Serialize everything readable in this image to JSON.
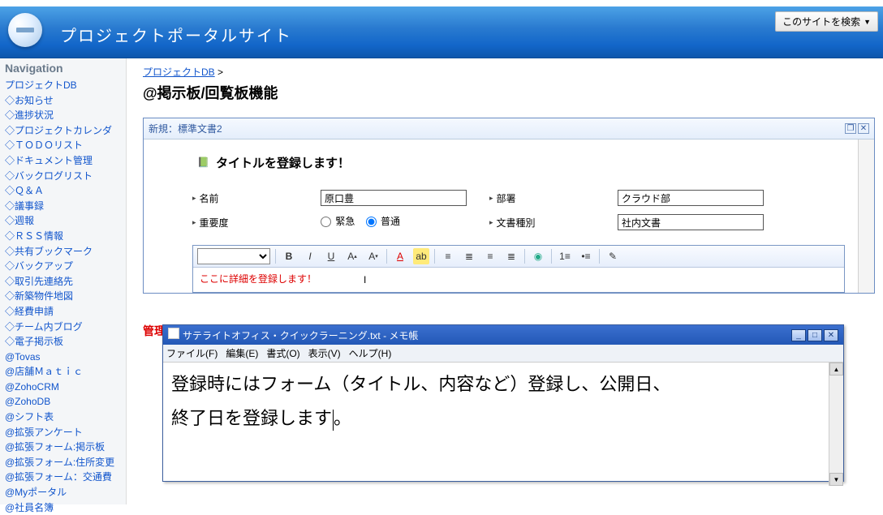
{
  "header": {
    "site_title": "プロジェクトポータルサイト",
    "search_button": "このサイトを検索"
  },
  "sidebar": {
    "heading": "Navigation",
    "items": [
      "プロジェクトDB",
      "◇お知らせ",
      "◇進捗状況",
      "◇プロジェクトカレンダ",
      "◇ＴＯＤＯリスト",
      "◇ドキュメント管理",
      "◇バックログリスト",
      "◇Ｑ＆Ａ",
      "◇議事録",
      "◇週報",
      "◇ＲＳＳ情報",
      "◇共有ブックマーク",
      "◇バックアップ",
      "◇取引先連絡先",
      "◇新築物件地図",
      "◇経費申請",
      "◇チーム内ブログ",
      "◇電子掲示板",
      "@Tovas",
      "@店舗Ｍａｔｉｃ",
      "@ZohoCRM",
      "@ZohoDB",
      "@シフト表",
      "@拡張アンケート",
      "@拡張フォーム:掲示板",
      "@拡張フォーム:住所変更",
      "@拡張フォーム：交通費",
      "@Myポータル",
      "@社員名簿"
    ]
  },
  "breadcrumb": {
    "link": "プロジェクトDB",
    "sep": ">"
  },
  "page_title": "@掲示板/回覧板機能",
  "panel": {
    "header": "新規：標準文書2",
    "ribbon_title": "タイトルを登録します！",
    "fields": {
      "name_label": "名前",
      "name_value": "原口豊",
      "dept_label": "部署",
      "dept_value": "クラウド部",
      "priority_label": "重要度",
      "priority_opt1": "緊急",
      "priority_opt2": "普通",
      "doctype_label": "文書種別",
      "doctype_value": "社内文書"
    },
    "rte_placeholder": "ここに詳細を登録します！"
  },
  "notepad": {
    "title": "サテライトオフィス・クイックラーニング.txt - メモ帳",
    "menu": {
      "file": "ファイル(F)",
      "edit": "編集(E)",
      "format": "書式(O)",
      "view": "表示(V)",
      "help": "ヘルプ(H)"
    },
    "body_line1": "登録時にはフォーム（タイトル、内容など）登録し、公開日、",
    "body_line2": "終了日を登録します"
  },
  "section_heading": "管理者画面",
  "toolbar_icons": {
    "bold": "B",
    "italic": "I",
    "underline": "U",
    "sup": "A↑",
    "sub": "A↓",
    "fontcolor": "A",
    "bgcolor": "ab",
    "alignl": "≡",
    "alignc": "≡",
    "alignr": "≡",
    "alignj": "≡",
    "link": "⊕",
    "ol": "1≡",
    "ul": "•≡",
    "misc": "✎"
  }
}
